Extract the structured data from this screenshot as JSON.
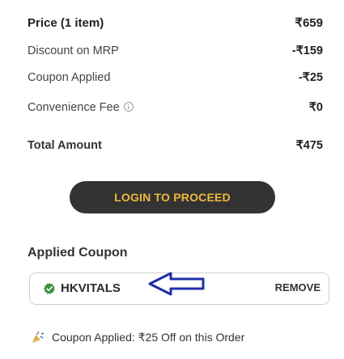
{
  "summary": {
    "price": {
      "label": "Price (1 item)",
      "value": "₹659"
    },
    "discount": {
      "label": "Discount on MRP",
      "value": "-₹159"
    },
    "coupon": {
      "label": "Coupon Applied",
      "value": "-₹25"
    },
    "convenience": {
      "label": "Convenience Fee",
      "value": "₹0"
    },
    "total": {
      "label": "Total Amount",
      "value": "₹475"
    }
  },
  "cta": {
    "label": "LOGIN TO PROCEED"
  },
  "applied_coupon": {
    "title": "Applied Coupon",
    "code": "HKVITALS",
    "remove_label": "REMOVE",
    "message": "Coupon Applied: ₹25 Off on this Order"
  },
  "colors": {
    "cta_bg": "#333333",
    "cta_text": "#f2b83a",
    "badge_green": "#3e8e41",
    "arrow": "#1f2fa8"
  }
}
